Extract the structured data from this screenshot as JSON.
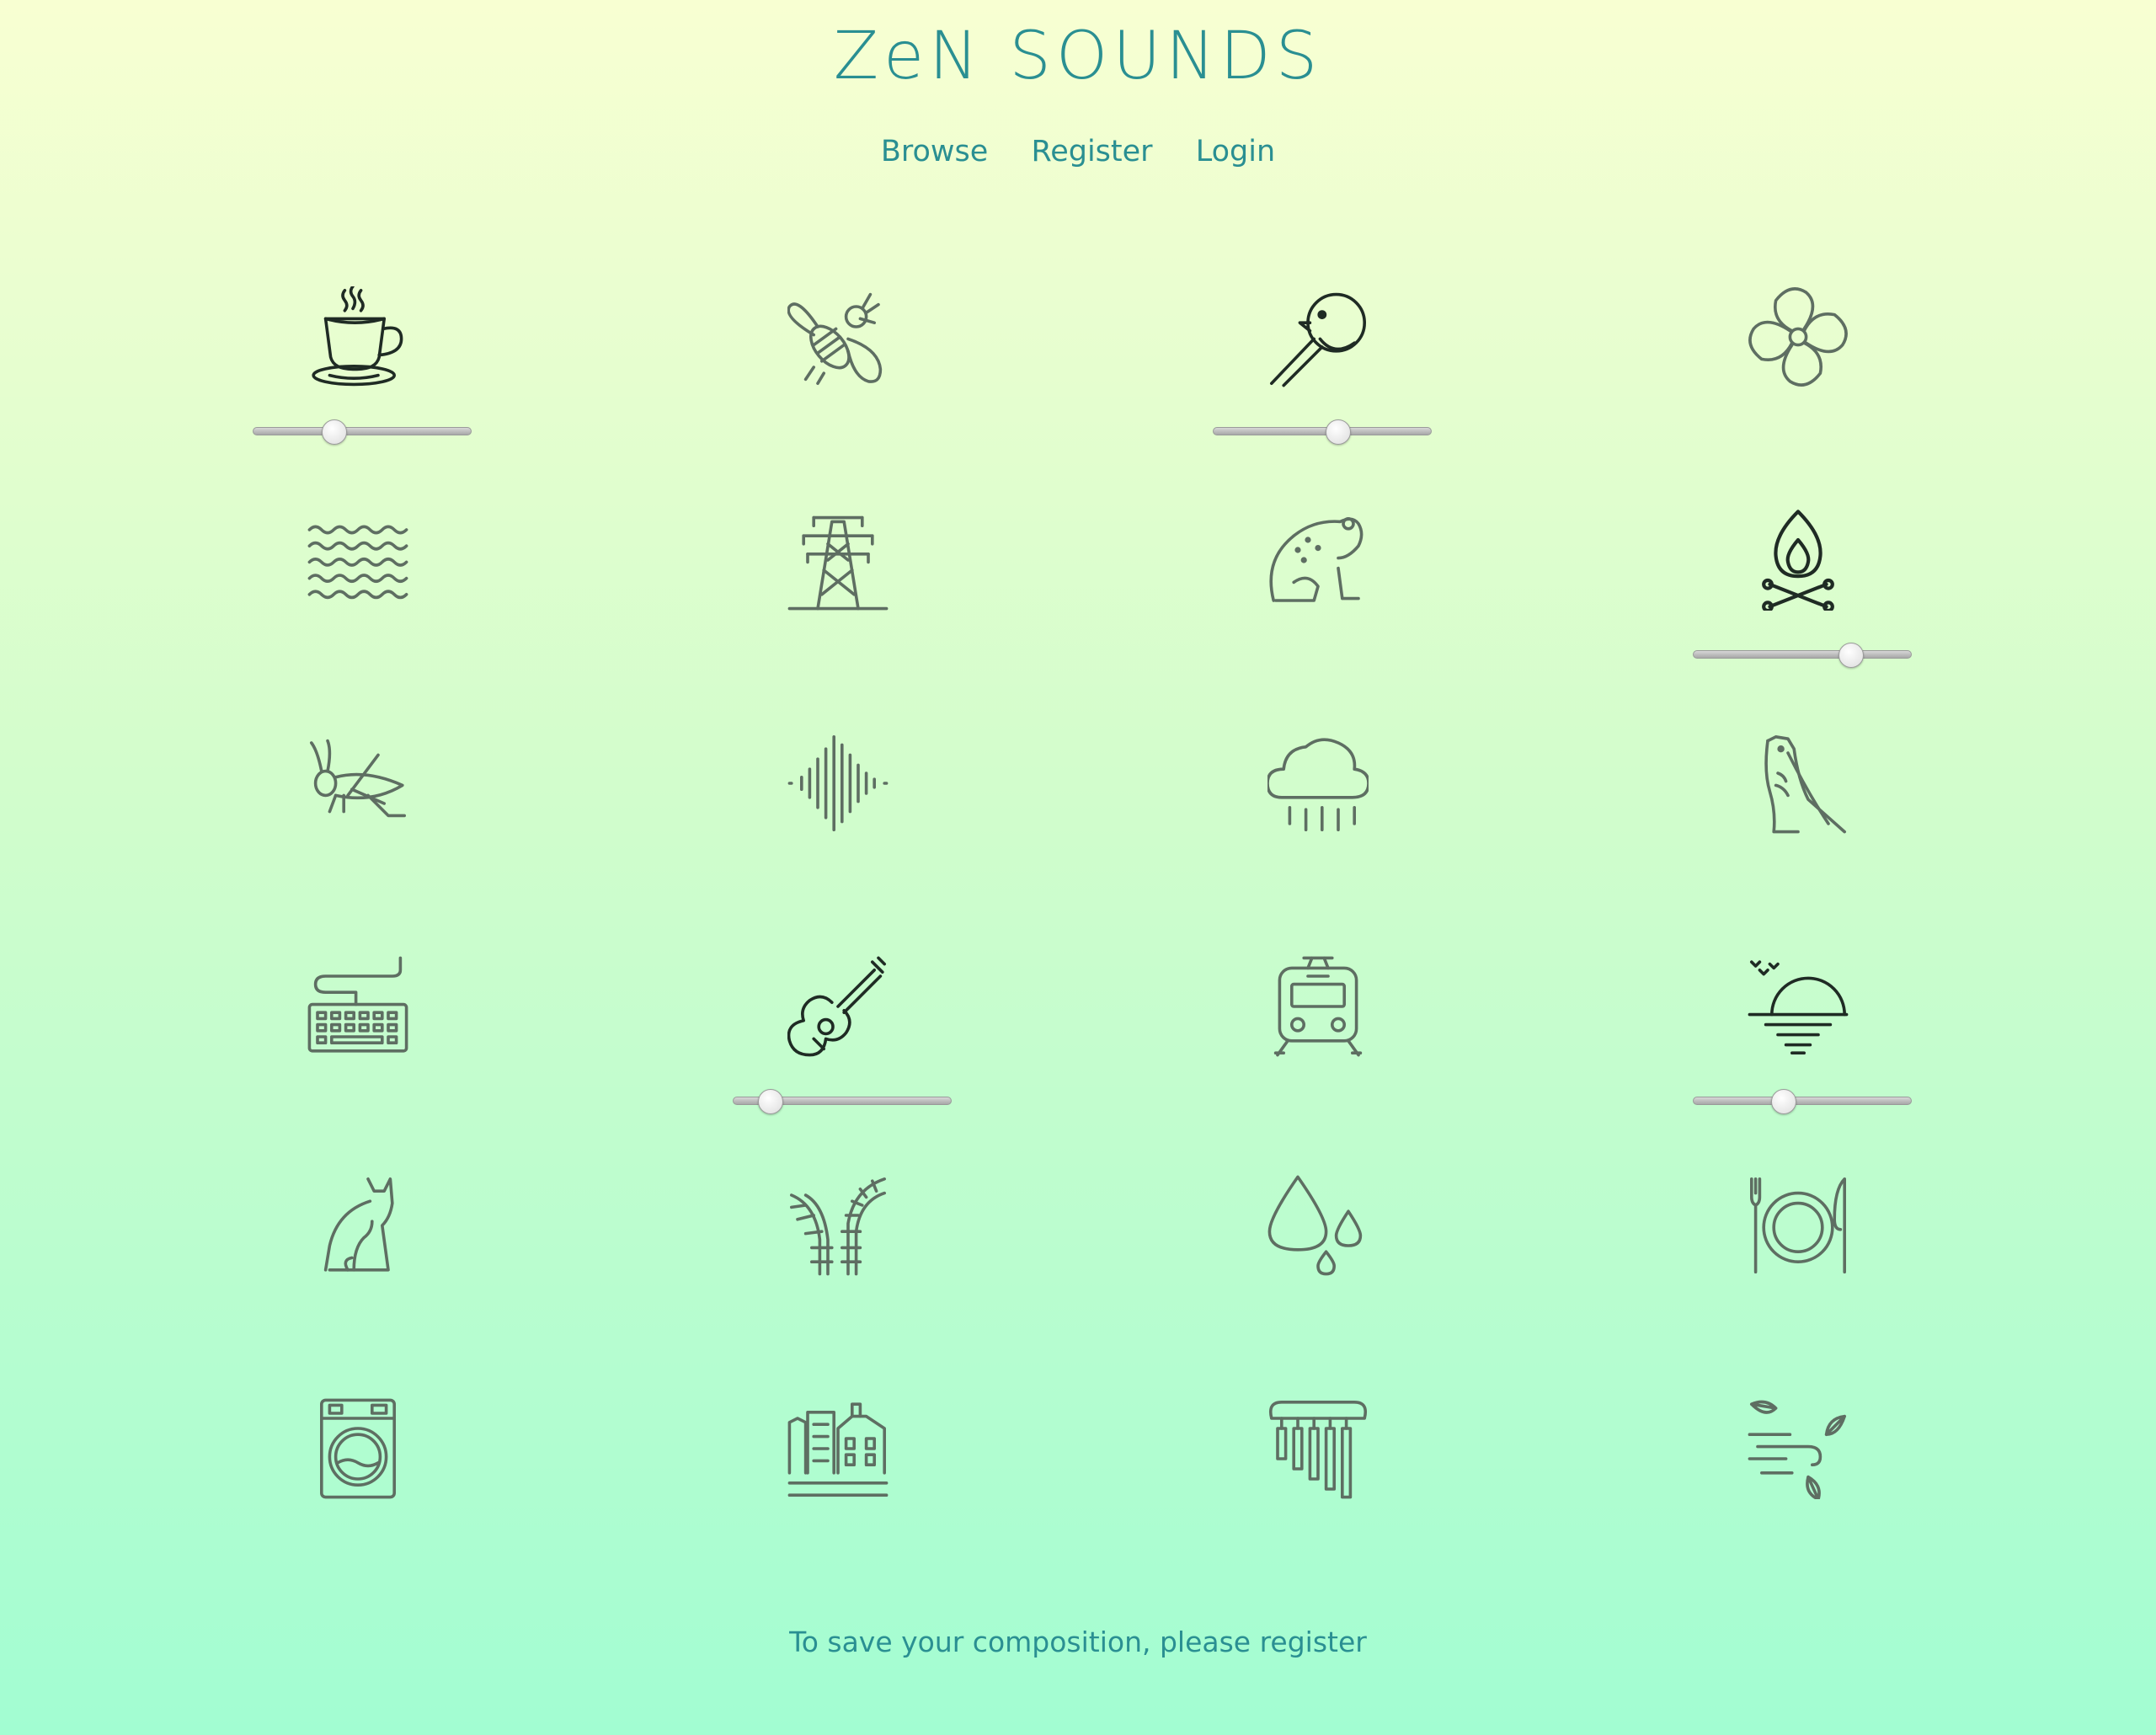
{
  "app": {
    "title": "ZeN SOUNDS"
  },
  "nav": {
    "browse": "Browse",
    "register": "Register",
    "login": "Login"
  },
  "footer": {
    "text": "To save your composition, please register"
  },
  "sounds": [
    {
      "icon": "coffee-cup-icon",
      "active": true,
      "level": 0.37
    },
    {
      "icon": "bee-icon",
      "active": false
    },
    {
      "icon": "bird-icon",
      "active": true,
      "level": 0.57
    },
    {
      "icon": "fan-icon",
      "active": false
    },
    {
      "icon": "waves-icon",
      "active": false
    },
    {
      "icon": "power-line-icon",
      "active": false
    },
    {
      "icon": "frog-icon",
      "active": false
    },
    {
      "icon": "campfire-icon",
      "active": true,
      "level": 0.72
    },
    {
      "icon": "cricket-icon",
      "active": false
    },
    {
      "icon": "white-noise-icon",
      "active": false
    },
    {
      "icon": "rain-cloud-icon",
      "active": false
    },
    {
      "icon": "owl-icon",
      "active": false
    },
    {
      "icon": "keyboard-icon",
      "active": false
    },
    {
      "icon": "guitar-icon",
      "active": true,
      "level": 0.17
    },
    {
      "icon": "train-icon",
      "active": false
    },
    {
      "icon": "sunset-icon",
      "active": true,
      "level": 0.41
    },
    {
      "icon": "cat-icon",
      "active": false
    },
    {
      "icon": "railway-tracks-icon",
      "active": false
    },
    {
      "icon": "water-drops-icon",
      "active": false
    },
    {
      "icon": "dinner-plate-icon",
      "active": false
    },
    {
      "icon": "washing-machine-icon",
      "active": false
    },
    {
      "icon": "city-icon",
      "active": false
    },
    {
      "icon": "wind-chimes-icon",
      "active": false
    },
    {
      "icon": "wind-leaves-icon",
      "active": false
    }
  ]
}
